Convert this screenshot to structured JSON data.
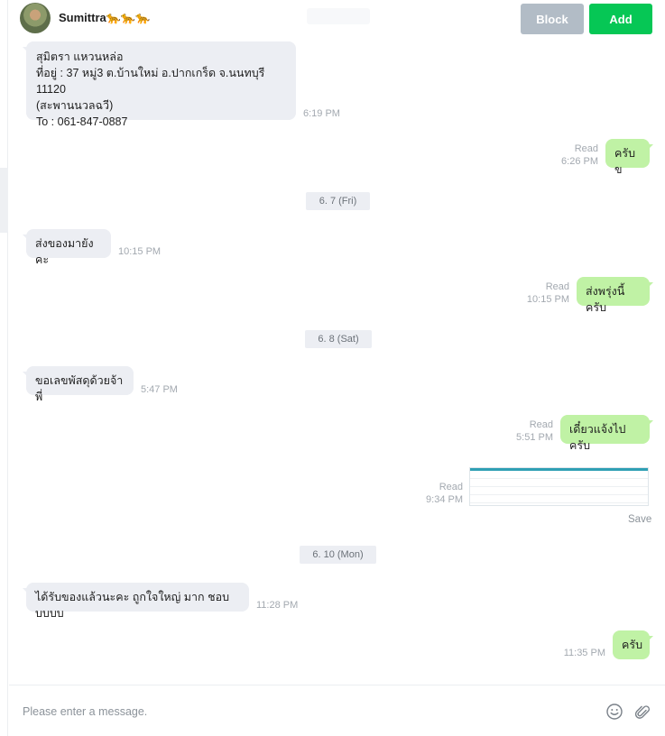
{
  "header": {
    "contact_name": "Sumittra🐆🐆🐆",
    "block_label": "Block",
    "add_label": "Add"
  },
  "messages": [
    {
      "dir": "in",
      "lines": [
        "สุมิตรา แหวนหล่อ",
        "ที่อยู่ : 37 หมู่3 ต.บ้านใหม่ อ.ปากเกร็ด จ.นนทบุรี 11120",
        "(สะพานนวลฉวี)",
        "To : 061-847-0887"
      ],
      "time": "6:19 PM"
    },
    {
      "dir": "out",
      "text": "ครับข",
      "read": "Read",
      "time": "6:26 PM"
    },
    {
      "dir": "in",
      "text": "ส่งของมายังคะ",
      "time": "10:15 PM"
    },
    {
      "dir": "out",
      "text": "ส่งพรุ่งนี้ครับ",
      "read": "Read",
      "time": "10:15 PM"
    },
    {
      "dir": "in",
      "text": "ขอเลขพัสดุด้วยจ้าพี่",
      "time": "5:47 PM"
    },
    {
      "dir": "out",
      "text": "เดี๋ยวแจ้งไปครับ",
      "read": "Read",
      "time": "5:51 PM"
    },
    {
      "dir": "out",
      "type": "image",
      "read": "Read",
      "time": "9:34 PM",
      "save_label": "Save"
    },
    {
      "dir": "in",
      "text": "ได้รับของแล้วนะคะ ถูกใจใหญ่ มาก ชอบบบบบ",
      "time": "11:28 PM"
    },
    {
      "dir": "out",
      "text": "ครับ",
      "time": "11:35 PM"
    }
  ],
  "dates": [
    "6. 7 (Fri)",
    "6. 8 (Sat)",
    "6. 10 (Mon)"
  ],
  "composer": {
    "placeholder": "Please enter a message."
  },
  "colors": {
    "add": "#06c755",
    "block": "#b2bcc6",
    "outgoing_bubble": "#c0f2a5",
    "incoming_bubble": "#eceef3"
  },
  "icons": {
    "emoji": "smiley-icon",
    "attach": "paperclip-icon"
  }
}
